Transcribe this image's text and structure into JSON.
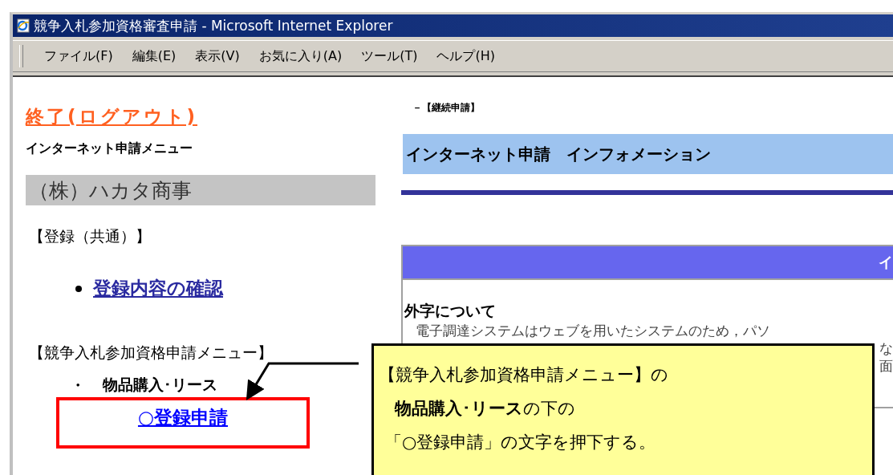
{
  "window": {
    "title": "競争入札参加資格審査申請 - Microsoft Internet Explorer"
  },
  "menu": [
    "ファイル(F)",
    "編集(E)",
    "表示(V)",
    "お気に入り(A)",
    "ツール(T)",
    "ヘルプ(H)"
  ],
  "sidebar": {
    "logout_link": "終了(ログアウト)",
    "menu_heading": "インターネット申請メニュー",
    "company_name": "（株）ハカタ商事",
    "sections": [
      {
        "heading": "【登録（共通）】",
        "items": [
          {
            "kind": "bullet_link",
            "label": "登録内容の確認"
          }
        ]
      },
      {
        "heading": "【競争入札参加資格申請メニュー】",
        "items": [
          {
            "kind": "subheading",
            "marker": "・",
            "label": "物品購入･リース",
            "children": [
              {
                "kind": "link",
                "label": "○登録申請",
                "highlighted": true
              }
            ]
          }
        ]
      }
    ]
  },
  "main": {
    "breadcrumb": "－【継続申請】",
    "banner": "インターネット申請　インフォメーション",
    "info_panel": {
      "header": "イ",
      "heading": "外字について",
      "lines": [
        "電子調達システムはウェブを用いたシステムのため，パソ",
        "な",
        "面"
      ]
    }
  },
  "callout": {
    "lines": [
      "【競争入札参加資格申請メニュー】の",
      "**物品購入･リース**の下の",
      "「○登録申請」の文字を押下する。"
    ]
  }
}
